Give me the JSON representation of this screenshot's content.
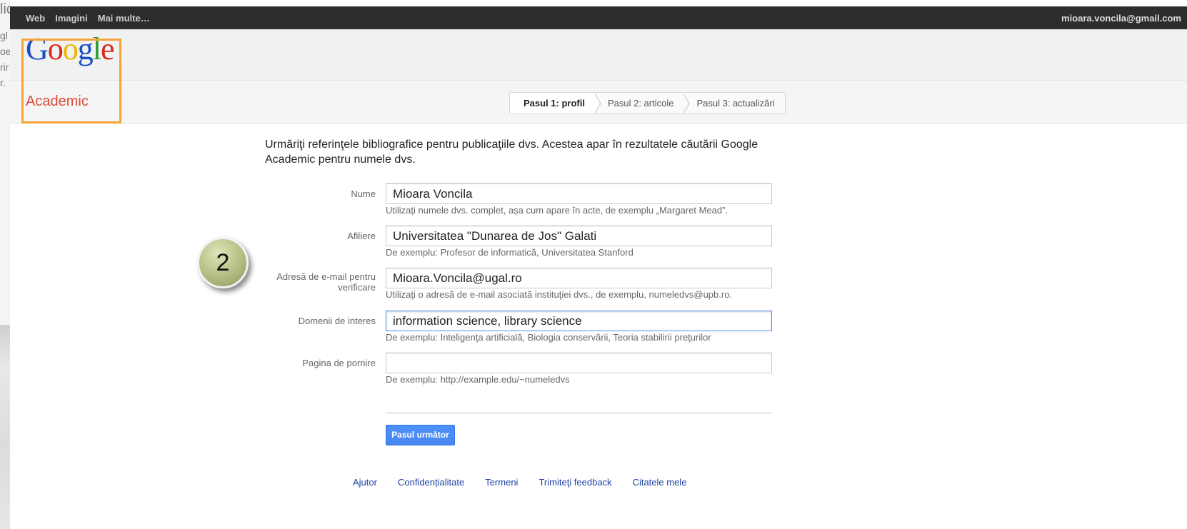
{
  "background": {
    "fragments": [
      "lic",
      "gl",
      "oe",
      "rir",
      "r."
    ]
  },
  "topbar": {
    "nav": [
      "Web",
      "Imagini",
      "Mai multe…"
    ],
    "user_email": "mioara.voncila@gmail.com"
  },
  "header": {
    "logo_letters": [
      "G",
      "o",
      "o",
      "g",
      "l",
      "e"
    ]
  },
  "subheader": {
    "brand": "Academic",
    "steps": [
      {
        "label": "Pasul 1: profil",
        "active": true
      },
      {
        "label": "Pasul 2: articole",
        "active": false
      },
      {
        "label": "Pasul 3: actualizări",
        "active": false
      }
    ]
  },
  "form": {
    "intro": "Urmăriţi referinţele bibliografice pentru publicaţiile dvs. Acestea apar în rezultatele căutării Google Academic pentru numele dvs.",
    "fields": [
      {
        "label": "Nume",
        "value": "Mioara Voncila",
        "hint": "Utilizați numele dvs. complet, așa cum apare în acte, de exemplu „Margaret Mead”."
      },
      {
        "label": "Afiliere",
        "value": "Universitatea \"Dunarea de Jos\" Galati",
        "hint": "De exemplu: Profesor de informatică, Universitatea Stanford"
      },
      {
        "label_line1": "Adresă de e-mail pentru",
        "label_line2": "verificare",
        "value": "Mioara.Voncila@ugal.ro",
        "hint": "Utilizaţi o adresă de e-mail asociată instituţiei dvs., de exemplu, numeledvs@upb.ro."
      },
      {
        "label": "Domenii de interes",
        "value": "information science, library science",
        "hint": "De exemplu: Inteligenţa artificială, Biologia conservării, Teoria stabilirii preţurilor"
      },
      {
        "label": "Pagina de pornire",
        "value": "",
        "hint": "De exemplu: http://example.edu/~numeledvs"
      }
    ],
    "next_button": "Pasul următor"
  },
  "annotation": {
    "number": "2"
  },
  "footer": {
    "links": [
      "Ajutor",
      "Confidențialitate",
      "Termeni",
      "Trimiteţi feedback",
      "Citatele mele"
    ]
  },
  "colors": {
    "topbar": "#2d2d2d",
    "brand": "#dd4b39",
    "highlight_border": "#f6a33a",
    "button": "#4d90fe",
    "link": "#1a3fa0"
  }
}
